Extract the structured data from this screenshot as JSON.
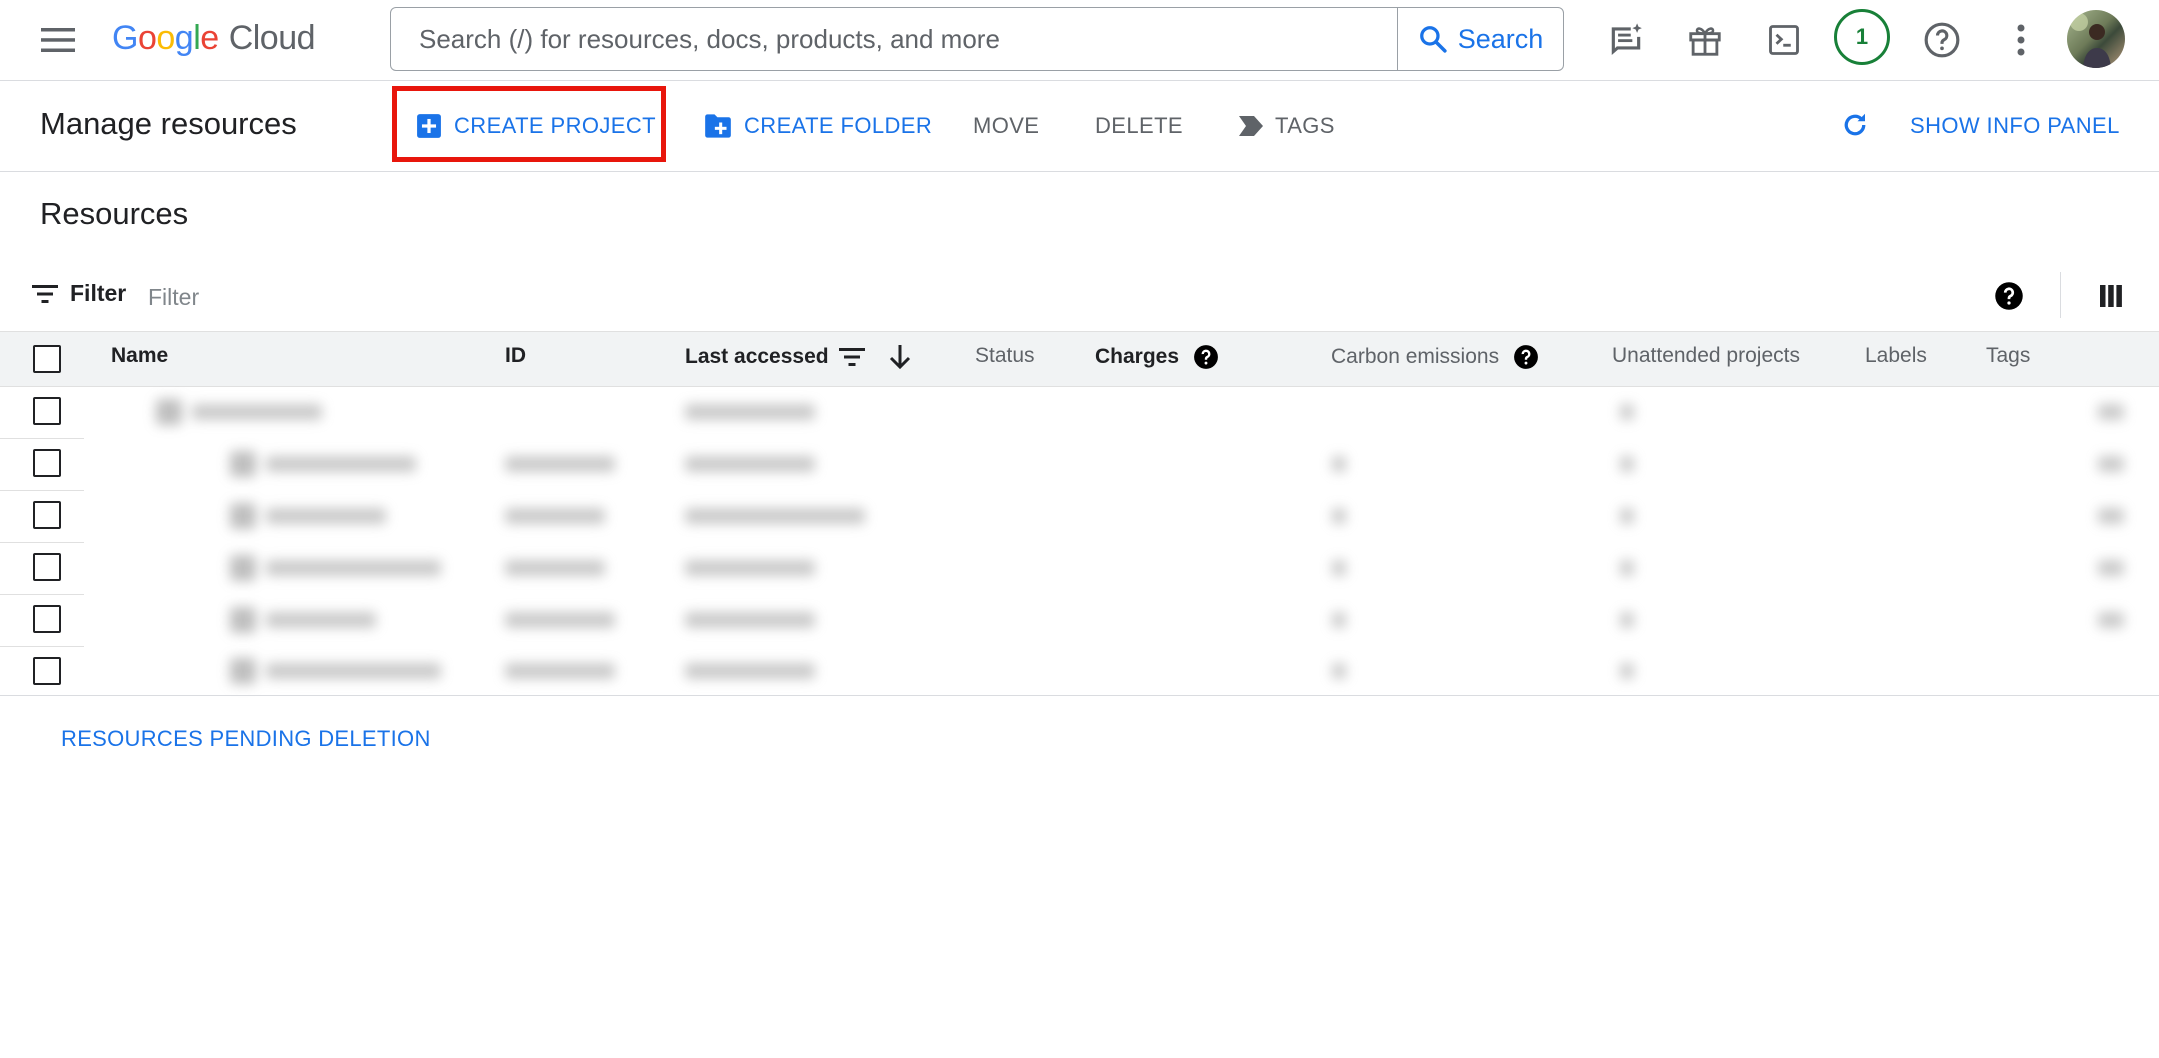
{
  "header": {
    "logo_letters": [
      "G",
      "o",
      "o",
      "g",
      "l",
      "e"
    ],
    "logo_product": "Cloud",
    "search_placeholder": "Search (/) for resources, docs, products, and more",
    "search_button_label": "Search",
    "notification_count": "1",
    "icons": [
      "hamburger-menu-icon",
      "search-icon",
      "feedback-icon",
      "gift-icon",
      "cloud-shell-icon",
      "help-icon",
      "more-vert-icon",
      "avatar"
    ]
  },
  "toolbar": {
    "title": "Manage resources",
    "create_project": "CREATE PROJECT",
    "create_folder": "CREATE FOLDER",
    "move": "MOVE",
    "delete": "DELETE",
    "tags": "TAGS",
    "show_info_panel": "SHOW INFO PANEL"
  },
  "resources": {
    "title": "Resources",
    "filter_label": "Filter",
    "filter_placeholder": "Filter",
    "columns": {
      "name": "Name",
      "id": "ID",
      "last_accessed": "Last accessed",
      "status": "Status",
      "charges": "Charges",
      "carbon_emissions": "Carbon emissions",
      "unattended_projects": "Unattended projects",
      "labels": "Labels",
      "tags": "Tags"
    },
    "row_count_visible": 6,
    "pending_deletion_link": "RESOURCES PENDING DELETION"
  },
  "colors": {
    "accent_blue": "#1a73e8",
    "highlight_red": "#e8160c",
    "notification_green": "#188038"
  }
}
